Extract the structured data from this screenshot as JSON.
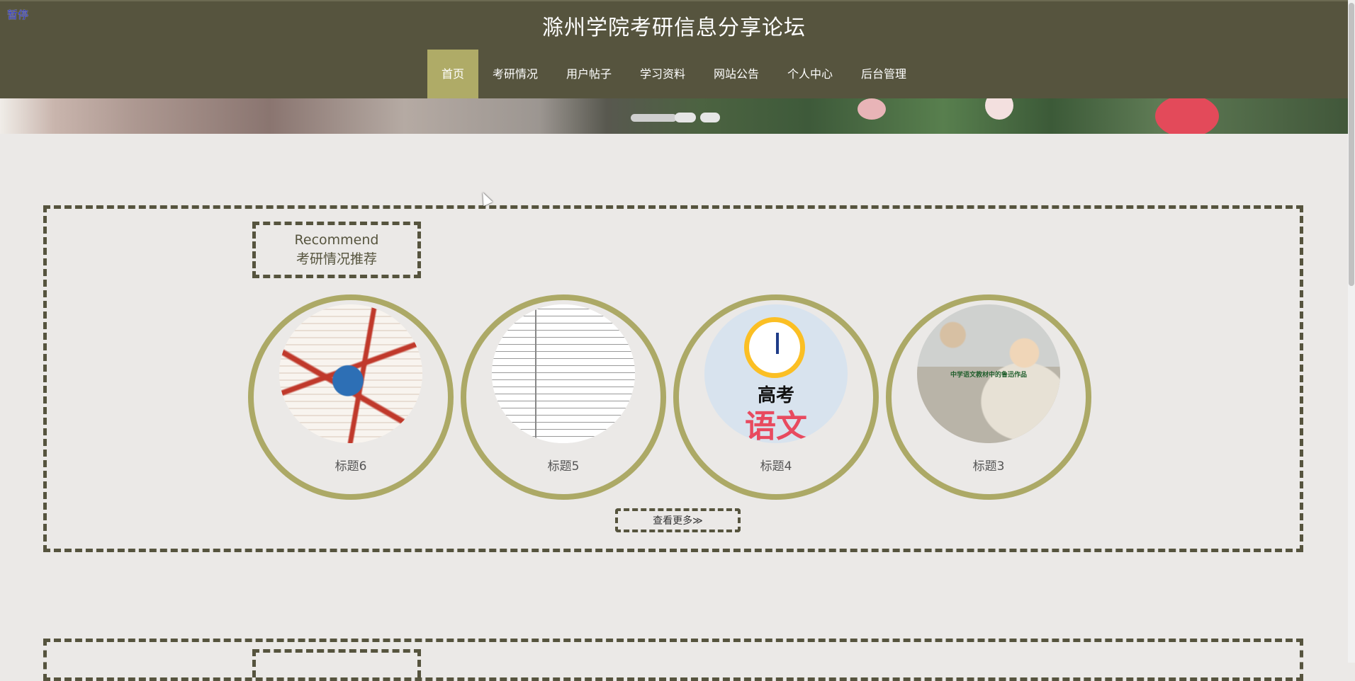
{
  "header": {
    "site_title": "滁州学院考研信息分享论坛",
    "pause_label": "暂停"
  },
  "nav": {
    "items": [
      {
        "label": "首页",
        "active": true
      },
      {
        "label": "考研情况"
      },
      {
        "label": "用户帖子"
      },
      {
        "label": "学习资料"
      },
      {
        "label": "网站公告"
      },
      {
        "label": "个人中心"
      },
      {
        "label": "后台管理"
      }
    ]
  },
  "recommend": {
    "heading_en": "Recommend",
    "heading_cn": "考研情况推荐",
    "cards": [
      {
        "title": "标题6",
        "image": "mind-map"
      },
      {
        "title": "标题5",
        "image": "table-document"
      },
      {
        "title": "标题4",
        "image": "alarm-clock-poster",
        "image_text_1": "高考",
        "image_text_2": "语文"
      },
      {
        "title": "标题3",
        "image": "classroom-scene",
        "image_text": "中学语文教材中的鲁迅作品"
      }
    ],
    "more_label": "查看更多≫"
  },
  "colors": {
    "header_bg": "#56543e",
    "accent": "#aca966",
    "page_bg": "#ebe9e7"
  }
}
